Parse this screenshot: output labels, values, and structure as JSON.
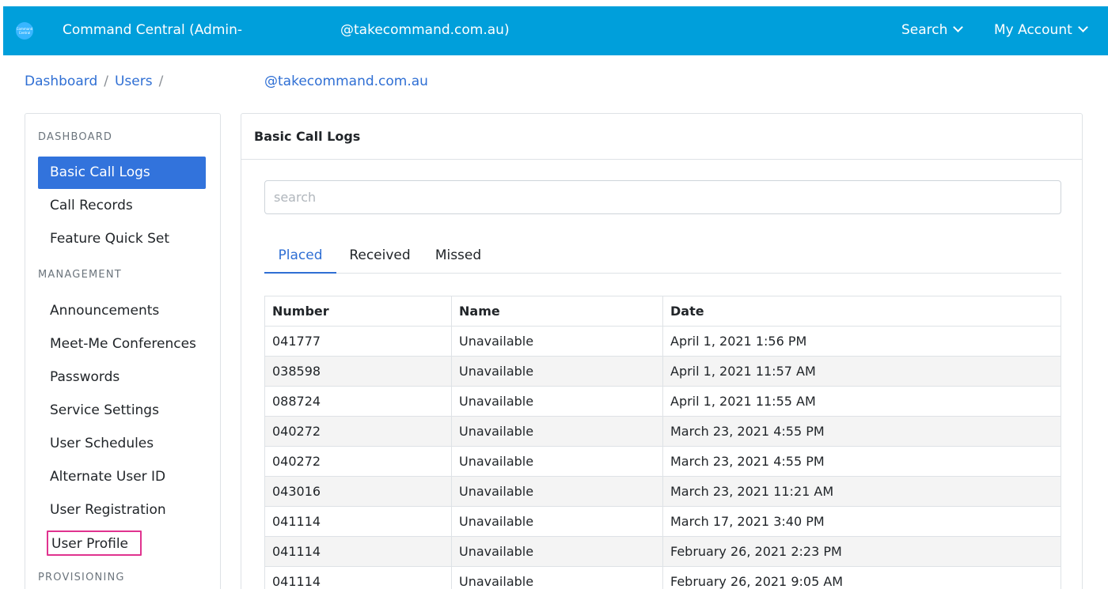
{
  "topbar": {
    "logo_text": "Command Central",
    "title_prefix": "Command Central (Admin-",
    "title_suffix": "@takecommand.com.au)",
    "search_label": "Search",
    "account_label": "My Account",
    "bg_color": "#009fdb"
  },
  "breadcrumb": {
    "items": [
      "Dashboard",
      "Users"
    ],
    "separator": "/",
    "current": "@takecommand.com.au"
  },
  "sidebar": {
    "sections": [
      {
        "title": "DASHBOARD",
        "items": [
          {
            "label": "Basic Call Logs",
            "active": true
          },
          {
            "label": "Call Records"
          },
          {
            "label": "Feature Quick Set"
          }
        ]
      },
      {
        "title": "MANAGEMENT",
        "items": [
          {
            "label": "Announcements"
          },
          {
            "label": "Meet-Me Conferences"
          },
          {
            "label": "Passwords"
          },
          {
            "label": "Service Settings"
          },
          {
            "label": "User Schedules"
          },
          {
            "label": "Alternate User ID"
          },
          {
            "label": "User Registration"
          },
          {
            "label": "User Profile",
            "highlighted": true
          }
        ]
      },
      {
        "title": "PROVISIONING",
        "items": []
      }
    ],
    "active_color": "#3273dc",
    "highlight_color": "#e0338f"
  },
  "main": {
    "card_title": "Basic Call Logs",
    "search_placeholder": "search",
    "tabs": [
      {
        "label": "Placed",
        "active": true
      },
      {
        "label": "Received"
      },
      {
        "label": "Missed"
      }
    ],
    "table": {
      "columns": [
        "Number",
        "Name",
        "Date"
      ],
      "rows": [
        [
          "041777",
          "Unavailable",
          "April 1, 2021 1:56 PM"
        ],
        [
          "038598",
          "Unavailable",
          "April 1, 2021 11:57 AM"
        ],
        [
          "088724",
          "Unavailable",
          "April 1, 2021 11:55 AM"
        ],
        [
          "040272",
          "Unavailable",
          "March 23, 2021 4:55 PM"
        ],
        [
          "040272",
          "Unavailable",
          "March 23, 2021 4:55 PM"
        ],
        [
          "043016",
          "Unavailable",
          "March 23, 2021 11:21 AM"
        ],
        [
          "041114",
          "Unavailable",
          "March 17, 2021 3:40 PM"
        ],
        [
          "041114",
          "Unavailable",
          "February 26, 2021 2:23 PM"
        ],
        [
          "041114",
          "Unavailable",
          "February 26, 2021 9:05 AM"
        ]
      ]
    },
    "accent_color": "#2f6fd4"
  }
}
